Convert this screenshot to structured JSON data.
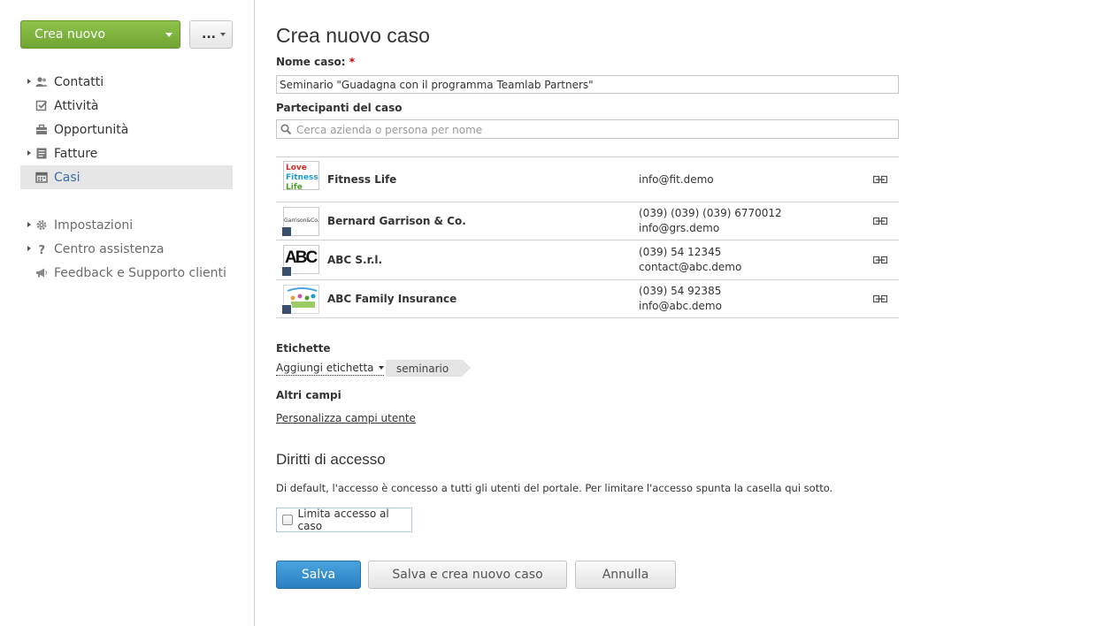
{
  "toolbar": {
    "create_label": "Crea nuovo",
    "more_label": "..."
  },
  "nav": {
    "items": [
      {
        "label": "Contatti",
        "icon": "contacts-icon",
        "expandable": true
      },
      {
        "label": "Attività",
        "icon": "tasks-icon",
        "expandable": false
      },
      {
        "label": "Opportunità",
        "icon": "opportunities-icon",
        "expandable": false
      },
      {
        "label": "Fatture",
        "icon": "invoices-icon",
        "expandable": true
      },
      {
        "label": "Casi",
        "icon": "cases-icon",
        "expandable": false,
        "active": true
      }
    ],
    "secondary": [
      {
        "label": "Impostazioni",
        "icon": "gear-icon",
        "expandable": true
      },
      {
        "label": "Centro assistenza",
        "icon": "help-icon",
        "expandable": true
      },
      {
        "label": "Feedback e Supporto clienti",
        "icon": "megaphone-icon",
        "expandable": false
      }
    ]
  },
  "form": {
    "title": "Crea nuovo caso",
    "case_name_label": "Nome caso:",
    "required_mark": "*",
    "case_name_value": "Seminario \"Guadagna con il programma Teamlab Partners\"",
    "participants_label": "Partecipanti del caso",
    "participants_placeholder": "Cerca azienda o persona per nome",
    "participants": [
      {
        "name": "Fitness Life",
        "info": [
          "info@fit.demo"
        ],
        "logo": "fitness-life-logo"
      },
      {
        "name": "Bernard Garrison & Co.",
        "info": [
          "(039) (039) (039) 6770012",
          "info@grs.demo"
        ],
        "logo": "garrison-logo"
      },
      {
        "name": "ABC S.r.l.",
        "info": [
          "(039) 54 12345",
          "contact@abc.demo"
        ],
        "logo": "abc-logo"
      },
      {
        "name": "ABC Family Insurance",
        "info": [
          "(039) 54 92385",
          "info@abc.demo"
        ],
        "logo": "family-insurance-logo"
      }
    ],
    "tags_label": "Etichette",
    "add_tag_label": "Aggiungi etichetta",
    "tags": [
      "seminario"
    ],
    "other_fields_label": "Altri campi",
    "customize_link": "Personalizza campi utente",
    "access_title": "Diritti di accesso",
    "access_desc": "Di default, l'accesso è concesso a tutti gli utenti del portale. Per limitare l'accesso spunta la casella qui sotto.",
    "restrict_label": "Limita accesso al caso",
    "restrict_checked": false,
    "save_label": "Salva",
    "save_new_label": "Salva e crea nuovo caso",
    "cancel_label": "Annulla"
  },
  "logo_text": {
    "fitness": [
      "Love",
      "Fitness",
      "Life"
    ],
    "garrison": "Garrison&Co.",
    "abc": "ABC"
  },
  "colors": {
    "primary_green": "#7ab33e",
    "primary_blue": "#3592d1",
    "active_nav_text": "#3a6ea5"
  }
}
